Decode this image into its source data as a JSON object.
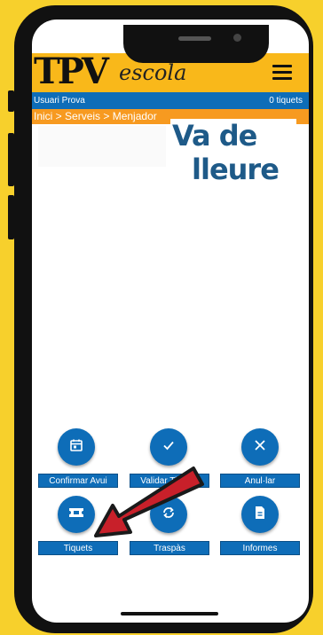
{
  "header": {
    "logo_main": "TPV",
    "logo_sub": "escola"
  },
  "user_bar": {
    "user": "Usuari Prova",
    "tickets": "0 tiquets"
  },
  "breadcrumb": "Inici > Serveis > Menjador",
  "brand_logo": {
    "line1": "Va de",
    "line2": "lleure"
  },
  "actions": [
    {
      "label": "Confirmar Avui",
      "icon": "calendar-icon"
    },
    {
      "label": "Validar Tiquets",
      "icon": "check-icon"
    },
    {
      "label": "Anul·lar",
      "icon": "close-icon"
    },
    {
      "label": "Tiquets",
      "icon": "ticket-icon"
    },
    {
      "label": "Traspàs",
      "icon": "sync-icon"
    },
    {
      "label": "Informes",
      "icon": "document-icon"
    }
  ],
  "colors": {
    "background": "#f7d02c",
    "header": "#f9b81a",
    "primary": "#0e6db8",
    "breadcrumb": "#f79a20",
    "arrow": "#c8202a"
  }
}
